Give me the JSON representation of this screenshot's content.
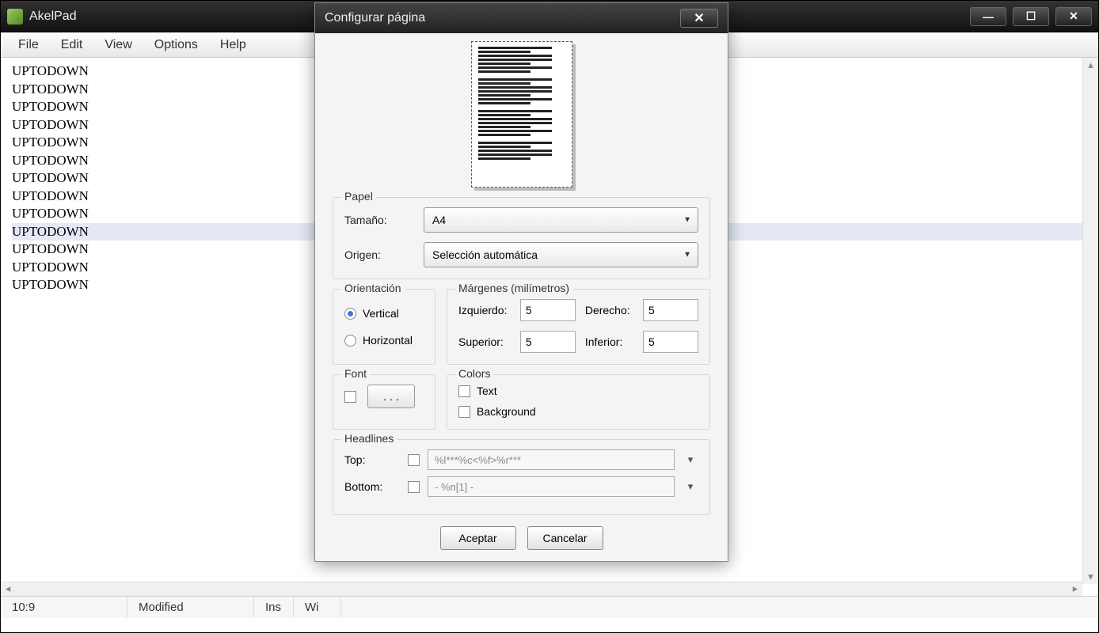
{
  "app": {
    "title": "AkelPad",
    "menu": [
      "File",
      "Edit",
      "View",
      "Options",
      "Help"
    ]
  },
  "editor": {
    "lines": [
      "UPTODOWN",
      "UPTODOWN",
      "UPTODOWN",
      "UPTODOWN",
      "UPTODOWN",
      "UPTODOWN",
      "UPTODOWN",
      "UPTODOWN",
      "UPTODOWN",
      "UPTODOWN",
      "UPTODOWN",
      "UPTODOWN",
      "UPTODOWN"
    ],
    "selected_index": 9
  },
  "statusbar": {
    "position": "10:9",
    "modified": "Modified",
    "insert_mode": "Ins",
    "encoding": "Wi"
  },
  "dialog": {
    "title": "Configurar página",
    "paper": {
      "legend": "Papel",
      "size_label": "Tamaño:",
      "size_value": "A4",
      "source_label": "Origen:",
      "source_value": "Selección automática"
    },
    "orientation": {
      "legend": "Orientación",
      "vertical": "Vertical",
      "horizontal": "Horizontal",
      "selected": "Vertical"
    },
    "margins": {
      "legend": "Márgenes (milímetros)",
      "left_label": "Izquierdo:",
      "left_value": "5",
      "right_label": "Derecho:",
      "right_value": "5",
      "top_label": "Superior:",
      "top_value": "5",
      "bottom_label": "Inferior:",
      "bottom_value": "5"
    },
    "font": {
      "legend": "Font",
      "ellipsis": ". . ."
    },
    "colors": {
      "legend": "Colors",
      "text": "Text",
      "background": "Background"
    },
    "headlines": {
      "legend": "Headlines",
      "top_label": "Top:",
      "top_value": "%l***%c<%f>%r***",
      "bottom_label": "Bottom:",
      "bottom_value": "- %n[1] -"
    },
    "buttons": {
      "ok": "Aceptar",
      "cancel": "Cancelar"
    }
  }
}
